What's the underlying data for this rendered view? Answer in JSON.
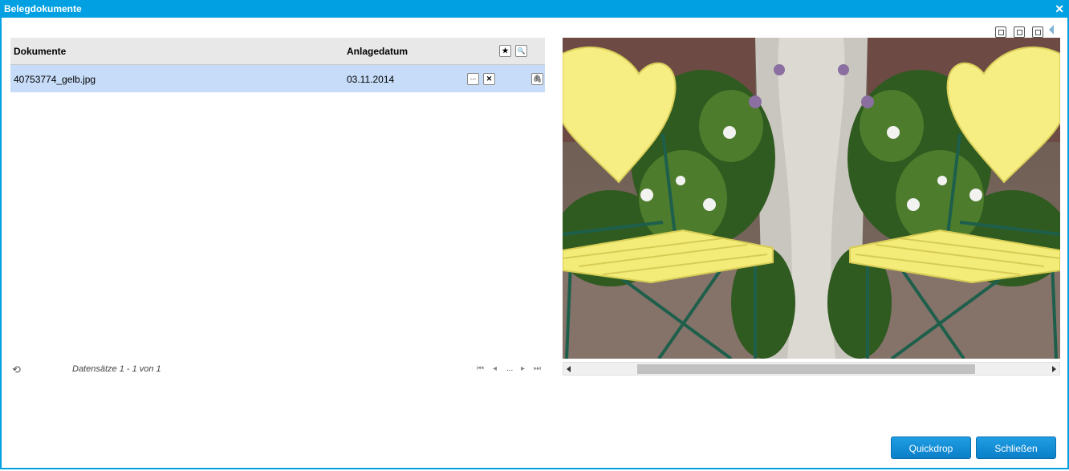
{
  "window": {
    "title": "Belegdokumente",
    "close_glyph": "✕"
  },
  "grid": {
    "columns": [
      "Dokumente",
      "Anlagedatum"
    ],
    "header_buttons": [
      {
        "icon": "star-icon",
        "glyph": "★"
      },
      {
        "icon": "search-icon",
        "glyph": "🔍"
      }
    ],
    "rows": [
      {
        "document": "40753774_gelb.jpg",
        "date": "03.11.2014",
        "more_glyph": "...",
        "delete_glyph": "✕",
        "attach_glyph": "🖇"
      }
    ],
    "footer": {
      "refresh_glyph": "⟲",
      "records_text": "Datensätze 1 - 1 von 1",
      "pager": {
        "first": "⏮",
        "prev": "◂",
        "ellipsis": "...",
        "next": "▸",
        "last": "⏭"
      }
    }
  },
  "preview": {
    "image_name": "40753774_gelb.jpg",
    "colors": {
      "heart": "#f6ee82",
      "seat": "#f4ec79",
      "frame": "#1e5f4c",
      "trunk": "#c9c6bf"
    }
  },
  "buttons": {
    "quickdrop": "Quickdrop",
    "close": "Schließen"
  },
  "colors": {
    "accent": "#00a0e3",
    "selected_row": "#c6dcf8",
    "button": "#0a7fc9"
  }
}
